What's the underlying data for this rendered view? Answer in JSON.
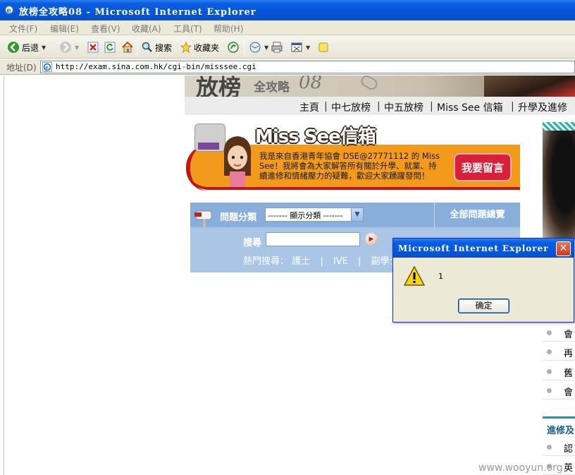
{
  "window": {
    "title": "放榜全攻略08 - Microsoft Internet Explorer"
  },
  "menubar": {
    "items": [
      "文件(F)",
      "编辑(E)",
      "查看(V)",
      "收藏(A)",
      "工具(T)",
      "帮助(H)"
    ]
  },
  "toolbar": {
    "back_label": "后退",
    "search_label": "搜索",
    "favorites_label": "收藏夹"
  },
  "address": {
    "label": "地址(D)",
    "url": "http://exam.sina.com.hk/cgi-bin/misssee.cgi"
  },
  "page": {
    "banner": {
      "big": "放榜",
      "small": "全攻略",
      "num": "08"
    },
    "nav": [
      "主頁",
      "中七放榜",
      "中五放榜",
      "Miss See 信箱",
      "升學及進修"
    ],
    "missee": {
      "title": "Miss See信箱",
      "description": "我是來自香港青年協會 DSE@27771112 的 Miss See！我將會為大家解答所有關於升學、就業、持續進修和情緒壓力的疑難，歡迎大家踴躍發問！",
      "message_button": "我要留言"
    },
    "search": {
      "category_label": "問題分類",
      "category_selected": "------- 顯示分類 -------",
      "all_questions": "全部問題總覽",
      "search_label": "搜尋",
      "search_value": "",
      "hot_label": "熱門搜尋：",
      "hot_items": [
        "護士",
        "IVE",
        "副學士"
      ]
    },
    "right_items": [
      "會",
      "再",
      "舊",
      "會"
    ],
    "right_section": "進修及",
    "right_items_2": [
      "認",
      "英"
    ]
  },
  "dialog": {
    "title": "Microsoft Internet Explorer",
    "message": "1",
    "ok_label": "确定",
    "close_label": "✕"
  },
  "watermark": "www.wooyun.org",
  "colors": {
    "titlebar": "#0556d8",
    "chrome": "#ece9d8",
    "missee_orange": "#f39a1d",
    "missee_red": "#c01818",
    "panel_blue": "#88aedc"
  }
}
